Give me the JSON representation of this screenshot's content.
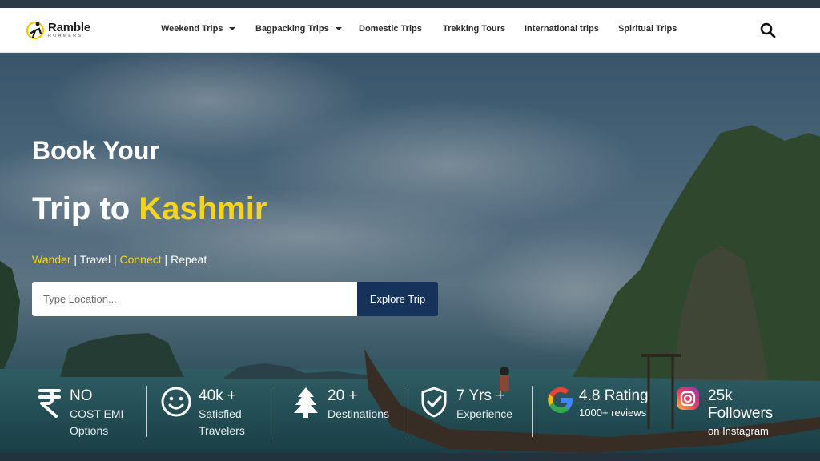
{
  "brand": {
    "name": "Ramble",
    "sub": "ROAMERS"
  },
  "nav": [
    {
      "label": "Weekend Trips",
      "dropdown": true
    },
    {
      "label": "Bagpacking Trips",
      "dropdown": true
    },
    {
      "label": "Domestic Trips",
      "dropdown": false
    },
    {
      "label": "Trekking Tours",
      "dropdown": false
    },
    {
      "label": "International trips",
      "dropdown": false
    },
    {
      "label": "Spiritual Trips",
      "dropdown": false
    }
  ],
  "hero": {
    "line1": "Book Your",
    "line2_prefix": "Trip to ",
    "line2_highlight": "Kashmir",
    "tagline": [
      {
        "text": "Wander",
        "highlight": true
      },
      {
        "text": " | ",
        "highlight": false
      },
      {
        "text": "Travel",
        "highlight": false
      },
      {
        "text": " | ",
        "highlight": false
      },
      {
        "text": "Connect",
        "highlight": true
      },
      {
        "text": " | ",
        "highlight": false
      },
      {
        "text": "Repeat",
        "highlight": false
      }
    ]
  },
  "search": {
    "placeholder": "Type Location...",
    "button": "Explore Trip"
  },
  "stats": [
    {
      "icon": "rupee-icon",
      "main": "NO",
      "sub": [
        "COST EMI",
        "Options"
      ]
    },
    {
      "icon": "smiley-icon",
      "main": "40k +",
      "sub": [
        "Satisfied",
        "Travelers"
      ]
    },
    {
      "icon": "tree-icon",
      "main": "20 +",
      "sub": [
        "Destinations"
      ]
    },
    {
      "icon": "shield-check-icon",
      "main": "7 Yrs +",
      "sub": [
        "Experience"
      ]
    },
    {
      "icon": "google-icon",
      "main": "4.8 Rating",
      "sub": [
        "1000+ reviews"
      ]
    },
    {
      "icon": "instagram-icon",
      "main": "25k",
      "sub": [
        "Followers",
        "on Instagram"
      ]
    }
  ],
  "colors": {
    "accent": "#f5d51c",
    "button": "#15335a",
    "nav_text": "#2b2b2b"
  }
}
